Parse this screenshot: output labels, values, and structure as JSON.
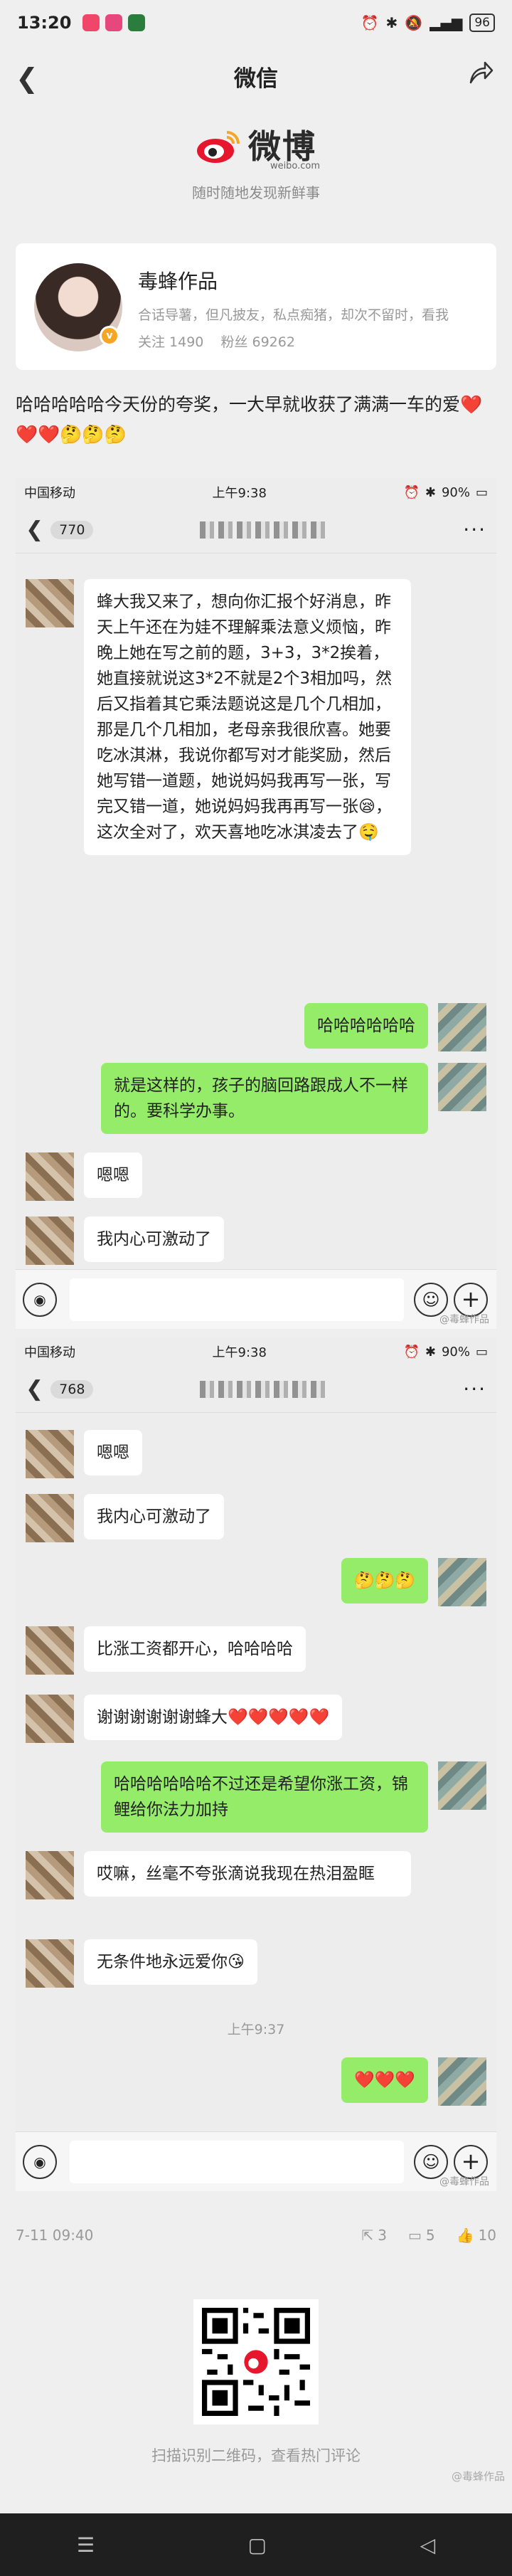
{
  "statusbar": {
    "time": "13:20",
    "battery": "96"
  },
  "nav": {
    "title": "微信"
  },
  "brand": {
    "logo_text": "微博",
    "logo_url": "weibo.com",
    "slogan": "随时随地发现新鲜事"
  },
  "profile": {
    "name": "毒蜂作品",
    "desc": "合话导薯，但凡披友，私点痴猪，却次不留时，看我",
    "follow": "关注 1490",
    "fans": "粉丝 69262"
  },
  "post": {
    "text": "哈哈哈哈哈今天份的夸奖，一大早就收获了满满一车的爱",
    "hearts": "❤️❤️❤️",
    "emojis": "🤔🤔🤔"
  },
  "shot1": {
    "carrier": "中国移动",
    "time": "上午9:38",
    "battery": "90%",
    "count": "770",
    "messages": [
      {
        "side": "left",
        "text": "蜂大我又来了，想向你汇报个好消息，昨天上午还在为娃不理解乘法意义烦恼，昨晚上她在写之前的题，3+3，3*2挨着，她直接就说这3*2不就是2个3相加吗，然后又指着其它乘法题说这是几个几相加，那是几个几相加，老母亲我很欣喜。她要吃冰淇淋，我说你都写对才能奖励，然后她写错一道题，她说妈妈我再写一张，写完又错一道，她说妈妈我再再写一张😪，这次全对了，欢天喜地吃冰淇凌去了🤤"
      },
      {
        "side": "right",
        "text": "哈哈哈哈哈哈"
      },
      {
        "side": "right",
        "text": "就是这样的，孩子的脑回路跟成人不一样的。要科学办事。"
      },
      {
        "side": "left",
        "text": "嗯嗯"
      },
      {
        "side": "left",
        "text": "我内心可激动了"
      },
      {
        "side": "right",
        "text": "🤔🤔🤔"
      }
    ],
    "watermark": "@毒蜂作品"
  },
  "shot2": {
    "carrier": "中国移动",
    "time": "上午9:38",
    "battery": "90%",
    "count": "768",
    "messages": [
      {
        "side": "left",
        "text": "嗯嗯"
      },
      {
        "side": "left",
        "text": "我内心可激动了"
      },
      {
        "side": "right",
        "text": "🤔🤔🤔"
      },
      {
        "side": "left",
        "text": "比涨工资都开心，哈哈哈哈"
      },
      {
        "side": "left",
        "text": "谢谢谢谢谢谢蜂大❤️❤️❤️❤️❤️"
      },
      {
        "side": "right",
        "text": "哈哈哈哈哈哈不过还是希望你涨工资，锦鲤给你法力加持"
      },
      {
        "side": "left",
        "text": "哎嘛，丝毫不夸张滴说我现在热泪盈眶"
      },
      {
        "side": "left",
        "text": "无条件地永远爱你😘"
      },
      {
        "side": "right",
        "text": "❤️❤️❤️"
      }
    ],
    "time_divider": "上午9:37",
    "watermark": "@毒蜂作品"
  },
  "meta": {
    "date": "7-11 09:40",
    "reposts": "3",
    "comments": "5",
    "likes": "10"
  },
  "qr": {
    "hint": "扫描识别二维码，查看热门评论"
  },
  "watermark": "@毒蜂作品",
  "colors": {
    "bubble_green": "#95ec69",
    "weibo_red": "#e6162d",
    "bg": "#efefef"
  }
}
